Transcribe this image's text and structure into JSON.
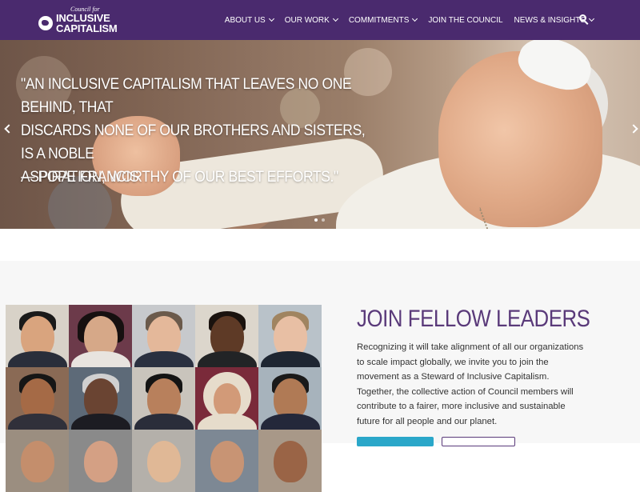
{
  "header": {
    "logo": {
      "small": "Council for",
      "line1": "INCLUSIVE",
      "line2": "CAPITALISM"
    },
    "nav": [
      {
        "label": "ABOUT US",
        "dropdown": true
      },
      {
        "label": "OUR WORK",
        "dropdown": true
      },
      {
        "label": "COMMITMENTS",
        "dropdown": true
      },
      {
        "label": "JOIN THE COUNCIL",
        "dropdown": false
      },
      {
        "label": "NEWS & INSIGHTS",
        "dropdown": true
      }
    ],
    "search_icon": "search-icon",
    "background_color": "#4a2a6e"
  },
  "hero": {
    "quote_line1": "\"An inclusive capitalism that leaves no one behind, that",
    "quote_line2": "discards none of our brothers and sisters, is a noble",
    "quote_line3": "aspiration, worthy of our best efforts.\"",
    "attribution": "— Pope Francis",
    "slide_count": 2,
    "active_slide": 1
  },
  "join": {
    "title": "JOIN FELLOW LEADERS",
    "body": "Recognizing it will take alignment of all our organizations to scale impact globally, we invite you to join the movement as a Steward of Inclusive Capitalism. Together, the collective action of Council members will contribute to a fairer, more inclusive and sustainable future for all people and our planet.",
    "title_color": "#5a3a7a",
    "primary_button_color": "#2aa7c9"
  }
}
